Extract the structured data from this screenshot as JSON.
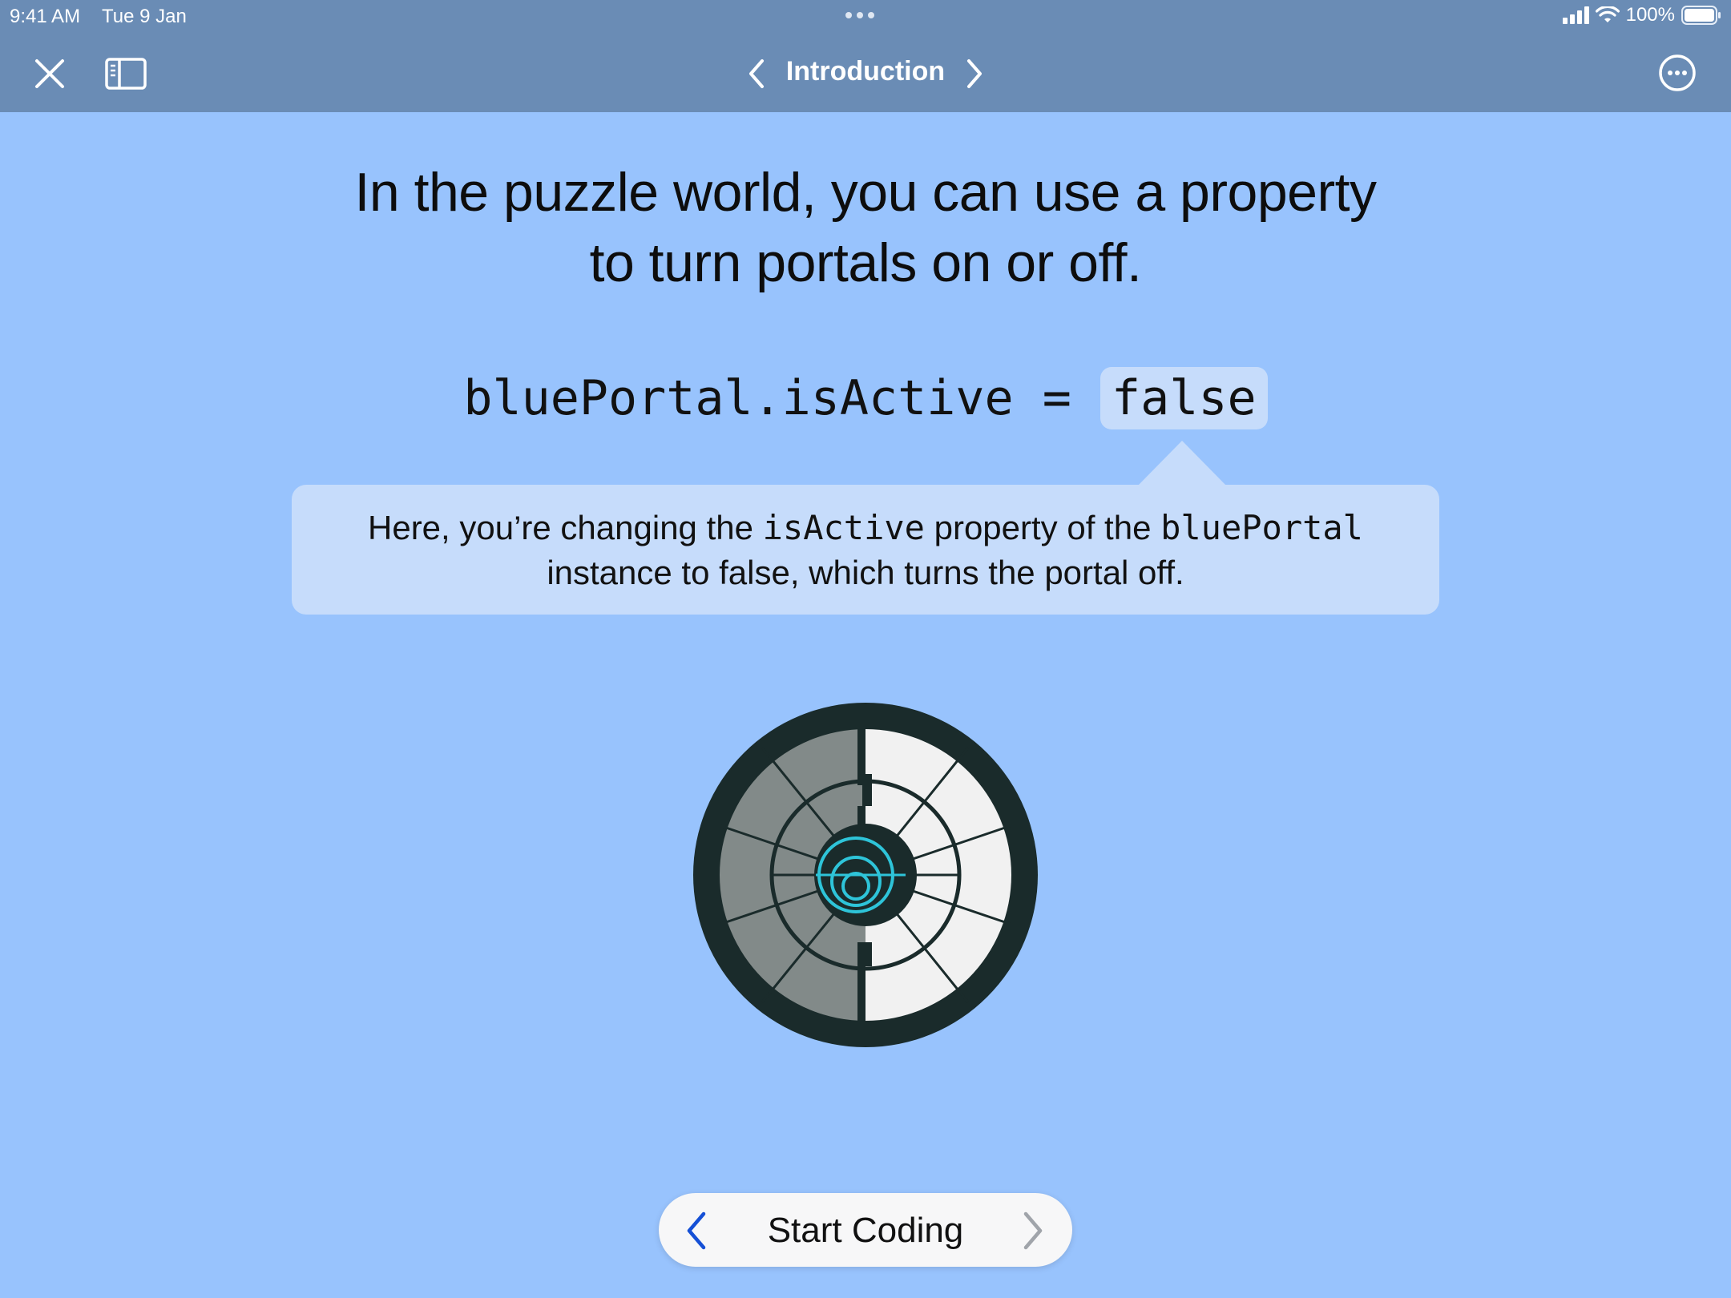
{
  "status_bar": {
    "time": "9:41 AM",
    "date": "Tue 9 Jan",
    "battery": "100%",
    "icons": [
      "signal-icon",
      "wifi-icon",
      "battery-icon"
    ]
  },
  "nav": {
    "title": "Introduction",
    "icons": [
      "close-icon",
      "sidebar-icon",
      "chevron-left-icon",
      "chevron-right-icon",
      "more-icon"
    ]
  },
  "content": {
    "headline_line1": "In the puzzle world, you can use a property",
    "headline_line2": "to turn portals on or off.",
    "code_prefix": "bluePortal.isActive = ",
    "code_value": "false",
    "callout": {
      "part1": "Here, you’re changing the ",
      "code1": "isActive",
      "part2": " property of the ",
      "code2": "bluePortal",
      "line2": "instance to false, which turns the portal off."
    }
  },
  "bottom_bar": {
    "start_label": "Start Coding"
  },
  "colors": {
    "background": "#98c3fd",
    "nav_bar": "#6a8cb5",
    "callout": "#c6dcfb",
    "portal_dark": "#1a2b2b",
    "portal_accent": "#2ec4d9",
    "arrow_active": "#1550d6"
  }
}
